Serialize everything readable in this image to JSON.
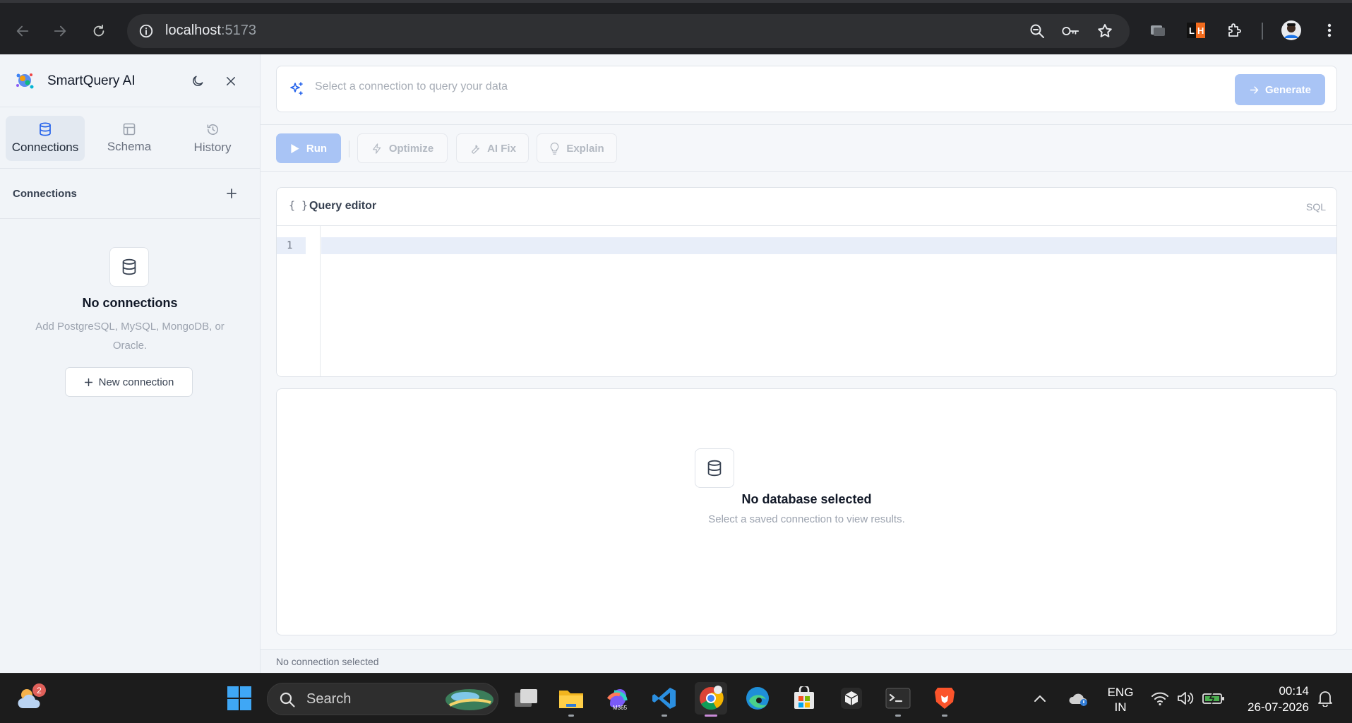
{
  "browser": {
    "url_host": "localhost",
    "url_port": ":5173"
  },
  "app": {
    "name": "SmartQuery AI",
    "tabs": [
      {
        "label": "Connections",
        "active": true
      },
      {
        "label": "Schema",
        "active": false
      },
      {
        "label": "History",
        "active": false
      }
    ],
    "connections": {
      "header": "Connections",
      "empty_title": "No connections",
      "empty_desc_line1": "Add PostgreSQL, MySQL, MongoDB, or",
      "empty_desc_line2": "Oracle.",
      "new_button": "New connection"
    },
    "prompt": {
      "placeholder": "Select a connection to query your data",
      "generate_label": "Generate"
    },
    "toolbar": {
      "run": "Run",
      "optimize": "Optimize",
      "ai_fix": "AI Fix",
      "explain": "Explain"
    },
    "editor": {
      "brace": "{ }",
      "title": "Query editor",
      "language": "SQL",
      "line_number": "1"
    },
    "results": {
      "empty_title": "No database selected",
      "empty_desc": "Select a saved connection to view results."
    },
    "status": "No connection selected",
    "colors": {
      "accent_disabled": "#a9c4f5",
      "active_line": "#e8eef9"
    }
  },
  "taskbar": {
    "weather_badge": "2",
    "search_label": "Search",
    "lang_line1": "ENG",
    "lang_line2": "IN",
    "time": "00:14",
    "date": "26-07-2026"
  }
}
